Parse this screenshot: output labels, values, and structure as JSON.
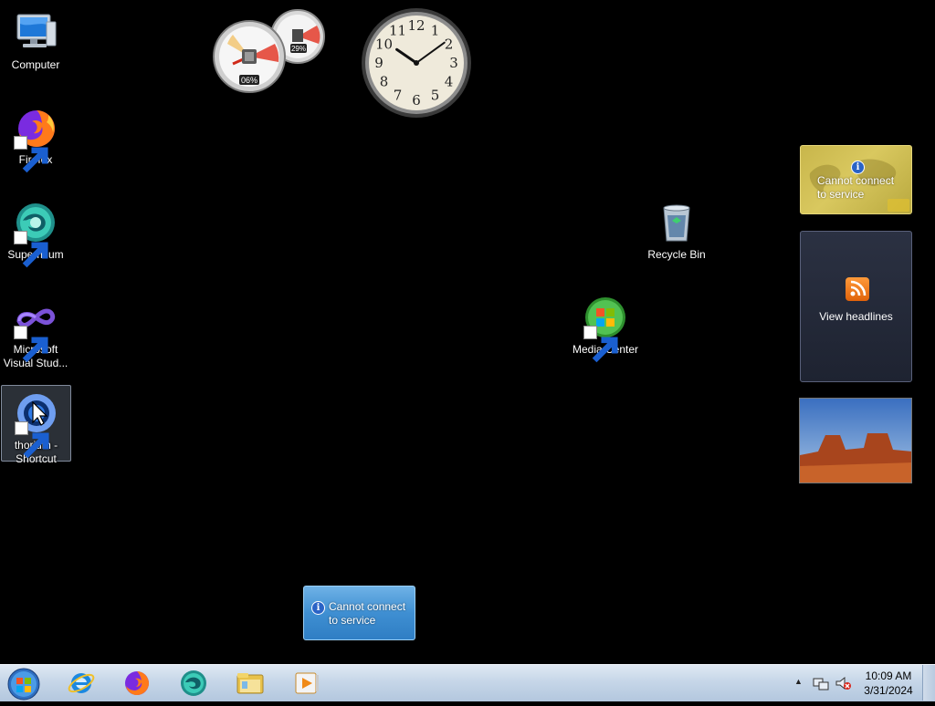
{
  "desktop_icons": [
    {
      "label": "Computer",
      "icon": "computer-icon"
    },
    {
      "label": "Firefox",
      "icon": "firefox-icon"
    },
    {
      "label": "Supermium",
      "icon": "supermium-icon"
    },
    {
      "label": "Microsoft Visual Stud...",
      "icon": "visual-studio-icon"
    },
    {
      "label": "thorium - Shortcut",
      "icon": "thorium-icon"
    },
    {
      "label": "Recycle Bin",
      "icon": "recycle-bin-icon"
    },
    {
      "label": "Media Center",
      "icon": "media-center-icon"
    }
  ],
  "gadgets": {
    "cpu_meter": {
      "cpu_percent": "06%",
      "memory_percent": "29%"
    },
    "clock": {
      "numbers": [
        "12",
        "1",
        "2",
        "3",
        "4",
        "5",
        "6",
        "7",
        "8",
        "9",
        "10",
        "11"
      ],
      "hour": 10,
      "minute": 9
    },
    "weather": {
      "message": "Cannot connect to service"
    },
    "feeds": {
      "label": "View headlines"
    },
    "currency": {
      "message": "Cannot connect to service"
    }
  },
  "taskbar": {
    "pinned": [
      "internet-explorer-icon",
      "firefox-icon",
      "supermium-icon",
      "file-explorer-icon",
      "media-player-icon"
    ],
    "clock": {
      "time": "10:09 AM",
      "date": "3/31/2024"
    }
  },
  "colors": {
    "desktop_bg": "#000000",
    "taskbar_top": "#dfe9f3",
    "weather_gold": "#c8b64b",
    "currency_blue": "#3f8fd2"
  }
}
